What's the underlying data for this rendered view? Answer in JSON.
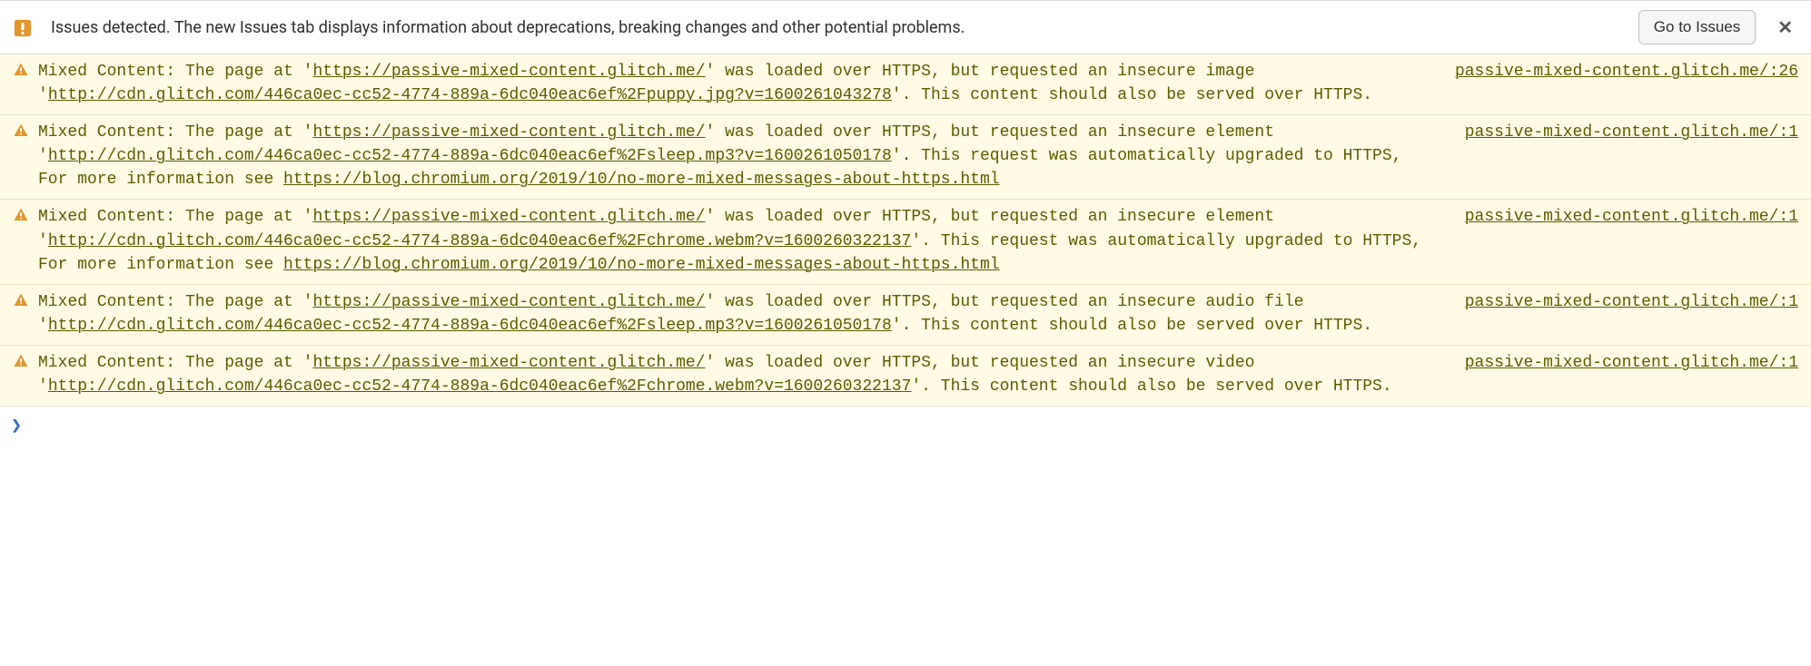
{
  "issues_bar": {
    "text": "Issues detected. The new Issues tab displays information about deprecations, breaking changes and other potential problems.",
    "button_label": "Go to Issues",
    "close_glyph": "✕"
  },
  "warnings": [
    {
      "segments": [
        {
          "t": "text",
          "v": "Mixed Content: The page at '"
        },
        {
          "t": "link",
          "v": "https://passive-mixed-content.glitch.me/"
        },
        {
          "t": "text",
          "v": "' was loaded over HTTPS, but requested an insecure image '"
        },
        {
          "t": "link",
          "v": "http://cdn.glitch.com/446ca0ec-cc52-4774-889a-6dc040eac6ef%2Fpuppy.jpg?v=1600261043278"
        },
        {
          "t": "text",
          "v": "'. This content should also be served over HTTPS."
        }
      ],
      "source": "passive-mixed-content.glitch.me/:26"
    },
    {
      "segments": [
        {
          "t": "text",
          "v": "Mixed Content: The page at '"
        },
        {
          "t": "link",
          "v": "https://passive-mixed-content.glitch.me/"
        },
        {
          "t": "text",
          "v": "' was loaded over HTTPS, but requested an insecure element '"
        },
        {
          "t": "link",
          "v": "http://cdn.glitch.com/446ca0ec-cc52-4774-889a-6dc040eac6ef%2Fsleep.mp3?v=1600261050178"
        },
        {
          "t": "text",
          "v": "'. This request was automatically upgraded to HTTPS, For more information see "
        },
        {
          "t": "link",
          "v": "https://blog.chromium.org/2019/10/no-more-mixed-messages-about-https.html"
        }
      ],
      "source": "passive-mixed-content.glitch.me/:1"
    },
    {
      "segments": [
        {
          "t": "text",
          "v": "Mixed Content: The page at '"
        },
        {
          "t": "link",
          "v": "https://passive-mixed-content.glitch.me/"
        },
        {
          "t": "text",
          "v": "' was loaded over HTTPS, but requested an insecure element '"
        },
        {
          "t": "link",
          "v": "http://cdn.glitch.com/446ca0ec-cc52-4774-889a-6dc040eac6ef%2Fchrome.webm?v=1600260322137"
        },
        {
          "t": "text",
          "v": "'. This request was automatically upgraded to HTTPS, For more information see "
        },
        {
          "t": "link",
          "v": "https://blog.chromium.org/2019/10/no-more-mixed-messages-about-https.html"
        }
      ],
      "source": "passive-mixed-content.glitch.me/:1"
    },
    {
      "segments": [
        {
          "t": "text",
          "v": "Mixed Content: The page at '"
        },
        {
          "t": "link",
          "v": "https://passive-mixed-content.glitch.me/"
        },
        {
          "t": "text",
          "v": "' was loaded over HTTPS, but requested an insecure audio file '"
        },
        {
          "t": "link",
          "v": "http://cdn.glitch.com/446ca0ec-cc52-4774-889a-6dc040eac6ef%2Fsleep.mp3?v=1600261050178"
        },
        {
          "t": "text",
          "v": "'. This content should also be served over HTTPS."
        }
      ],
      "source": "passive-mixed-content.glitch.me/:1"
    },
    {
      "segments": [
        {
          "t": "text",
          "v": "Mixed Content: The page at '"
        },
        {
          "t": "link",
          "v": "https://passive-mixed-content.glitch.me/"
        },
        {
          "t": "text",
          "v": "' was loaded over HTTPS, but requested an insecure video '"
        },
        {
          "t": "link",
          "v": "http://cdn.glitch.com/446ca0ec-cc52-4774-889a-6dc040eac6ef%2Fchrome.webm?v=1600260322137"
        },
        {
          "t": "text",
          "v": "'. This content should also be served over HTTPS."
        }
      ],
      "source": "passive-mixed-content.glitch.me/:1"
    }
  ],
  "prompt_glyph": "❯"
}
